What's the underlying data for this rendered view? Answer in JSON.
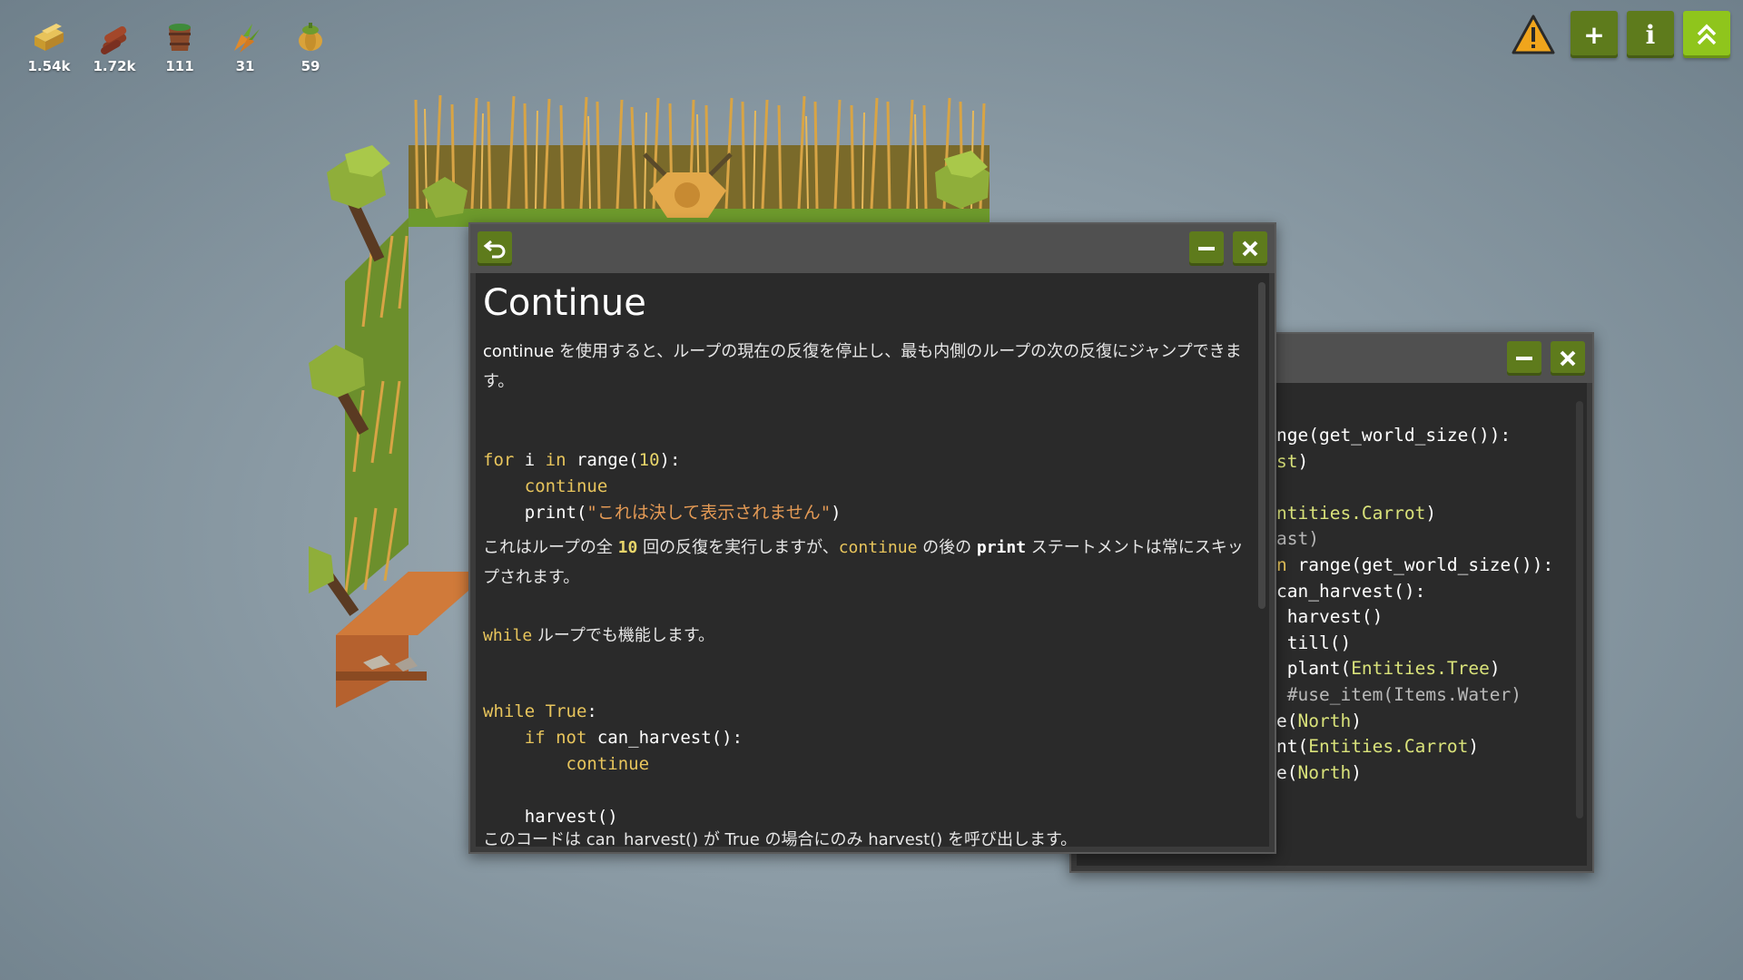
{
  "resources": [
    {
      "icon": "hay-bale-icon",
      "count": "1.54k"
    },
    {
      "icon": "wood-logs-icon",
      "count": "1.72k"
    },
    {
      "icon": "water-bucket-icon",
      "count": "111"
    },
    {
      "icon": "carrot-icon",
      "count": "31"
    },
    {
      "icon": "pumpkin-icon",
      "count": "59"
    }
  ],
  "top_right": {
    "add_label": "+",
    "info_label": "i"
  },
  "doc": {
    "title": "Continue",
    "para1_a": "continue",
    "para1_b": " を使用すると、ループの現在の反復を停止し、最も内側のループの次の反復にジャンプできます。",
    "code1": {
      "l1_kw1": "for",
      "l1_var": " i ",
      "l1_kw2": "in",
      "l1_fn": " range(",
      "l1_num": "10",
      "l1_end": "):",
      "l2": "continue",
      "l3_fn": "print(",
      "l3_str": "\"これは決して表示されません\"",
      "l3_end": ")"
    },
    "para2_a": "これはループの全 ",
    "para2_num": "10",
    "para2_b": " 回の反復を実行しますが、",
    "para2_kw": "continue",
    "para2_c": " の後の ",
    "para2_fn": "print",
    "para2_d": " ステートメントは常にスキップされます。",
    "para3_kw": "while",
    "para3_b": " ループでも機能します。",
    "code2": {
      "l1_kw": "while",
      "l1_val": " True",
      "l1_end": ":",
      "l2_kw1": "if",
      "l2_kw2": " not",
      "l2_fn": " can_harvest():",
      "l3": "continue",
      "l4": "harvest()"
    },
    "para4": "このコードは can_harvest() が True の場合にのみ harvest() を呼び出します。"
  },
  "editor": {
    "lines": [
      {
        "segs": [
          [
            "fn",
            "nge(get_world_size()):"
          ]
        ]
      },
      {
        "segs": [
          [
            "ent",
            "st"
          ],
          [
            "fn",
            ")"
          ]
        ]
      },
      {
        "segs": []
      },
      {
        "segs": [
          [
            "ent",
            "ntities.Carrot"
          ],
          [
            "fn",
            ")"
          ]
        ]
      },
      {
        "segs": [
          [
            "cm",
            "ast)"
          ]
        ]
      },
      {
        "segs": [
          [
            "kw",
            "n"
          ],
          [
            "fn",
            " range(get_world_size()):"
          ]
        ]
      },
      {
        "segs": [
          [
            "fn",
            "can_harvest():"
          ]
        ]
      },
      {
        "segs": [
          [
            "fn",
            " harvest()"
          ]
        ]
      },
      {
        "segs": [
          [
            "fn",
            " till()"
          ]
        ]
      },
      {
        "segs": [
          [
            "fn",
            " plant("
          ],
          [
            "ent",
            "Entities.Tree"
          ],
          [
            "fn",
            ")"
          ]
        ]
      },
      {
        "segs": [
          [
            "cm",
            " #use_item(Items.Water)"
          ]
        ]
      },
      {
        "segs": [
          [
            "fn",
            "e("
          ],
          [
            "ent",
            "North"
          ],
          [
            "fn",
            ")"
          ]
        ]
      },
      {
        "segs": [
          [
            "fn",
            "nt("
          ],
          [
            "ent",
            "Entities.Carrot"
          ],
          [
            "fn",
            ")"
          ]
        ]
      },
      {
        "segs": [
          [
            "fn",
            "e("
          ],
          [
            "ent",
            "North"
          ],
          [
            "fn",
            ")"
          ]
        ]
      }
    ]
  }
}
